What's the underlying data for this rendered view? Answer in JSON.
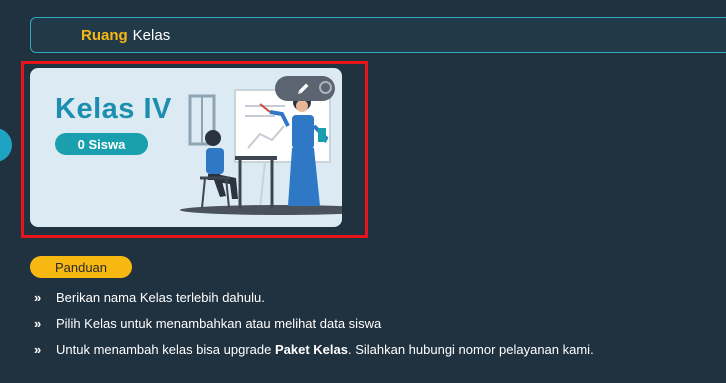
{
  "header": {
    "accent": "Ruang",
    "title": "Kelas"
  },
  "class_card": {
    "name": "Kelas IV",
    "student_count": "0 Siswa",
    "edit_icon": "pencil-icon",
    "more_icon": "circle-icon"
  },
  "guide": {
    "label": "Panduan",
    "bullet": "»",
    "items": [
      {
        "text": "Berikan nama Kelas terlebih dahulu."
      },
      {
        "text": "Pilih Kelas untuk menambahkan atau melihat data siswa"
      },
      {
        "pre": "Untuk menambah kelas bisa upgrade ",
        "bold": "Paket Kelas",
        "post": ". Silahkan hubungi nomor pelayanan kami."
      }
    ]
  },
  "colors": {
    "background": "#20313f",
    "accent_yellow": "#f7b812",
    "teal": "#1a9fae",
    "highlight_red": "#e8141b"
  }
}
